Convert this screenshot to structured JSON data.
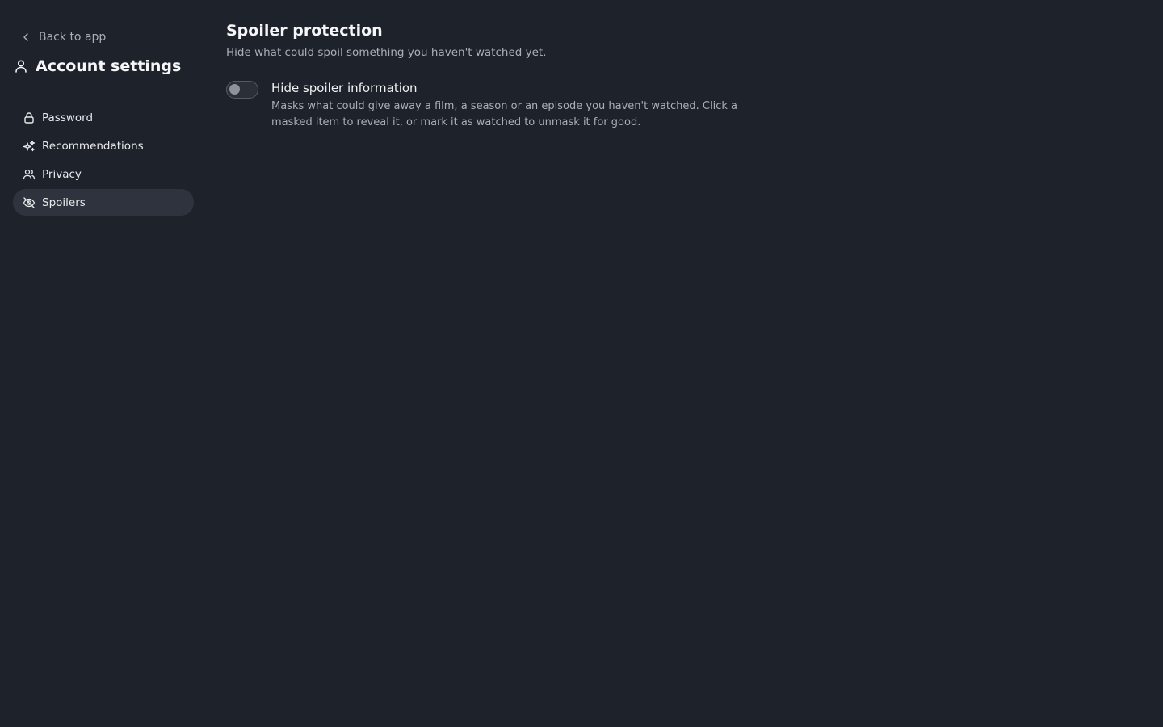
{
  "sidebar": {
    "back_label": "Back to app",
    "title": "Account settings",
    "items": [
      {
        "label": "Password",
        "icon": "lock-icon"
      },
      {
        "label": "Recommendations",
        "icon": "sparkles-icon"
      },
      {
        "label": "Privacy",
        "icon": "users-icon"
      },
      {
        "label": "Spoilers",
        "icon": "eye-off-icon",
        "active": true
      }
    ]
  },
  "main": {
    "title": "Spoiler protection",
    "subtitle": "Hide what could spoil something you haven't watched yet.",
    "settings": [
      {
        "label": "Hide spoiler information",
        "description": "Masks what could give away a film, a season or an episode you haven't watched. Click a masked item to reveal it, or mark it as watched to unmask it for good.",
        "enabled": false
      }
    ]
  },
  "colors": {
    "background": "#1e222b",
    "active_nav": "#2e333d",
    "muted_text": "#a9aeb8",
    "text": "#e8eaed"
  }
}
